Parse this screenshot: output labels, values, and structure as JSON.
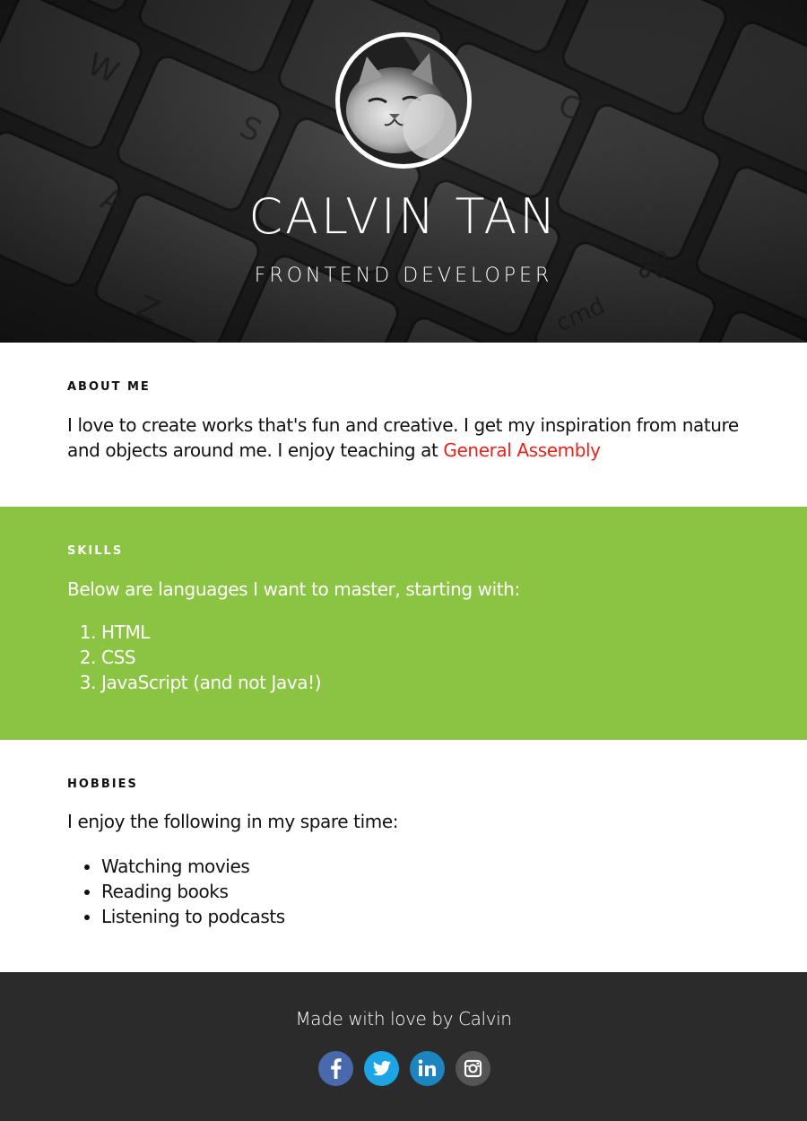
{
  "header": {
    "name": "CALVIN TAN",
    "role": "FRONTEND DEVELOPER",
    "avatar_icon": "cat-avatar-icon"
  },
  "about": {
    "heading": "ABOUT ME",
    "text": "I love to create works that's fun and creative. I get my inspiration from nature and objects around me. I enjoy teaching at ",
    "link_label": "General Assembly"
  },
  "skills": {
    "heading": "SKILLS",
    "intro": "Below are languages I want to master, starting with:",
    "items": [
      "HTML",
      "CSS",
      "JavaScript (and not Java!)"
    ]
  },
  "hobbies": {
    "heading": "HOBBIES",
    "intro": "I enjoy the following in my spare time:",
    "items": [
      "Watching movies",
      "Reading books",
      "Listening to podcasts"
    ]
  },
  "footer": {
    "text": "Made with love by Calvin",
    "social": [
      {
        "name": "facebook-icon",
        "color": "#4a69ad"
      },
      {
        "name": "twitter-icon",
        "color": "#1da4e3"
      },
      {
        "name": "linkedin-icon",
        "color": "#1d84bd"
      },
      {
        "name": "instagram-icon",
        "color": "#555555"
      }
    ]
  },
  "colors": {
    "accent_green": "#8bc443",
    "link_red": "#e8231c",
    "footer_bg": "#2b2b2b",
    "header_bg": "#2e2e2f"
  }
}
